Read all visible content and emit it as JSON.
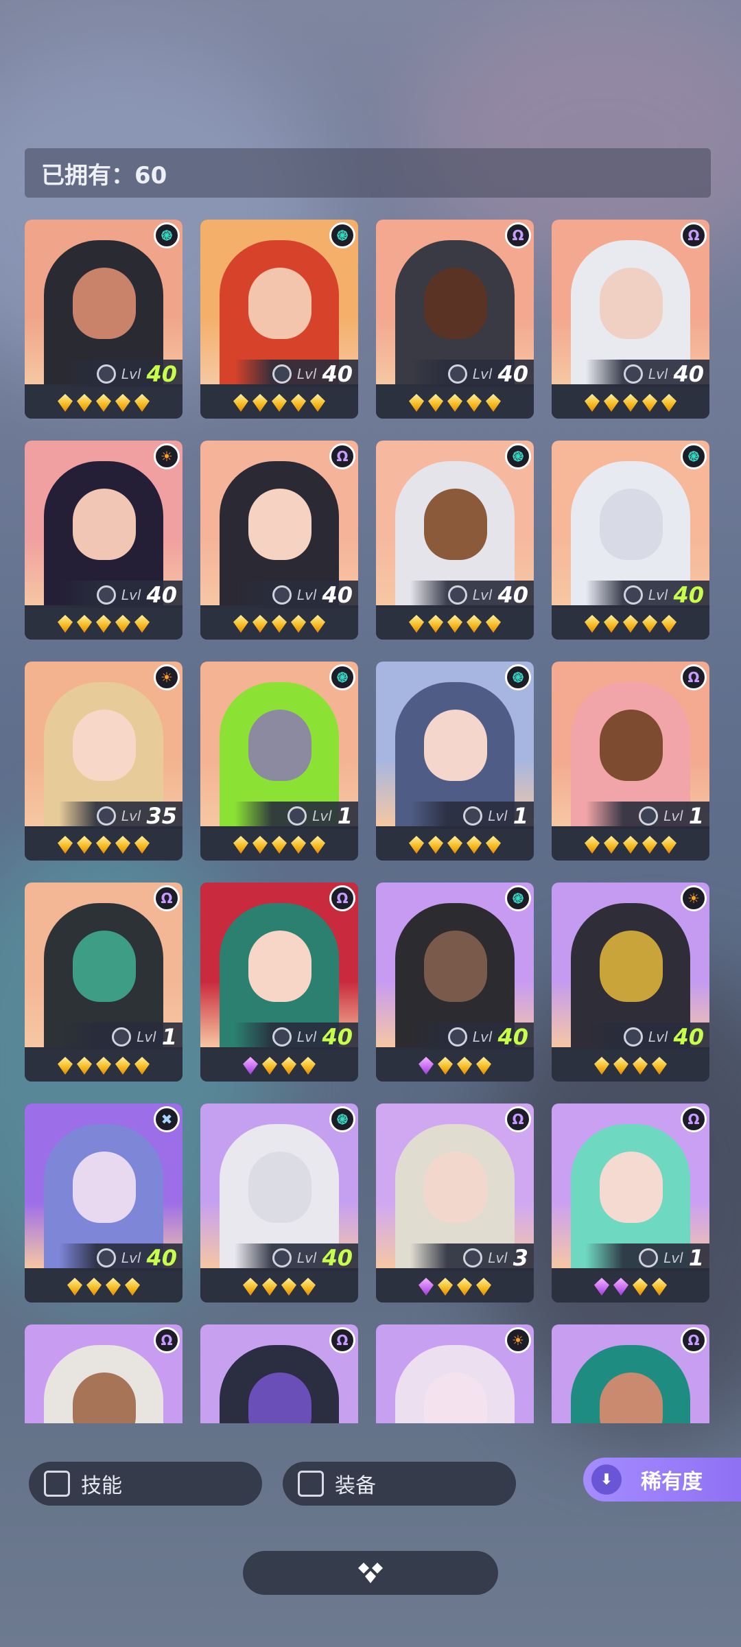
{
  "header": {
    "owned_text": "已拥有：60"
  },
  "lvl_prefix": "Lvl",
  "cards": [
    {
      "level": "40",
      "rarity": "swirl",
      "stars": [
        "gold",
        "gold",
        "gold",
        "gold",
        "gold"
      ],
      "lvl_color": "#c8ff4a",
      "bg": "#f0a58a",
      "figure": "#2a2a33",
      "face": "#c8836a"
    },
    {
      "level": "40",
      "rarity": "swirl",
      "stars": [
        "gold",
        "gold",
        "gold",
        "gold",
        "gold"
      ],
      "lvl_color": "#ffffff",
      "bg": "#f4b06a",
      "figure": "#d7422a",
      "face": "#f3c5ad"
    },
    {
      "level": "40",
      "rarity": "omega",
      "stars": [
        "gold",
        "gold",
        "gold",
        "gold",
        "gold"
      ],
      "lvl_color": "#ffffff",
      "bg": "#f3a88f",
      "figure": "#3a3a44",
      "face": "#5a3324"
    },
    {
      "level": "40",
      "rarity": "omega",
      "stars": [
        "gold",
        "gold",
        "gold",
        "gold",
        "gold"
      ],
      "lvl_color": "#ffffff",
      "bg": "#f3a88f",
      "figure": "#e8eaf0",
      "face": "#f0d0c2"
    },
    {
      "level": "40",
      "rarity": "sun",
      "stars": [
        "gold",
        "gold",
        "gold",
        "gold",
        "gold"
      ],
      "lvl_color": "#ffffff",
      "bg": "#f0a0a0",
      "figure": "#241f36",
      "face": "#f2c6b4"
    },
    {
      "level": "40",
      "rarity": "omega",
      "stars": [
        "gold",
        "gold",
        "gold",
        "gold",
        "gold"
      ],
      "lvl_color": "#ffffff",
      "bg": "#f5b49a",
      "figure": "#2b2a34",
      "face": "#f6d2c3"
    },
    {
      "level": "40",
      "rarity": "swirl",
      "stars": [
        "gold",
        "gold",
        "gold",
        "gold",
        "gold"
      ],
      "lvl_color": "#ffffff",
      "bg": "#f6b9a0",
      "figure": "#e4e4ea",
      "face": "#8a5a3a"
    },
    {
      "level": "40",
      "rarity": "swirl",
      "stars": [
        "gold",
        "gold",
        "gold",
        "gold",
        "gold"
      ],
      "lvl_color": "#c8ff4a",
      "bg": "#f7b89a",
      "figure": "#e8eaf2",
      "face": "#d8dbe6"
    },
    {
      "level": "35",
      "rarity": "sun",
      "stars": [
        "gold",
        "gold",
        "gold",
        "gold",
        "gold"
      ],
      "lvl_color": "#ffffff",
      "bg": "#f3b38f",
      "figure": "#e7cc9a",
      "face": "#f7d7c8"
    },
    {
      "level": "1",
      "rarity": "swirl",
      "stars": [
        "gold",
        "gold",
        "gold",
        "gold",
        "gold"
      ],
      "lvl_color": "#ffffff",
      "bg": "#f4b494",
      "figure": "#8ce234",
      "face": "#8c8aa0"
    },
    {
      "level": "1",
      "rarity": "swirl",
      "stars": [
        "gold",
        "gold",
        "gold",
        "gold",
        "gold"
      ],
      "lvl_color": "#ffffff",
      "bg": "#a7b6e0",
      "figure": "#4f5d86",
      "face": "#f4d6cc"
    },
    {
      "level": "1",
      "rarity": "omega",
      "stars": [
        "gold",
        "gold",
        "gold",
        "gold",
        "gold"
      ],
      "lvl_color": "#ffffff",
      "bg": "#f3aa90",
      "figure": "#f1a5a8",
      "face": "#7d4b2f"
    },
    {
      "level": "1",
      "rarity": "omega",
      "stars": [
        "gold",
        "gold",
        "gold",
        "gold",
        "gold"
      ],
      "lvl_color": "#ffffff",
      "bg": "#f4b796",
      "figure": "#2d3236",
      "face": "#3d9d85"
    },
    {
      "level": "40",
      "rarity": "omega",
      "stars": [
        "purple",
        "gold",
        "gold",
        "gold"
      ],
      "lvl_color": "#c8ff4a",
      "bg": "#c92a3d",
      "figure": "#2b8070",
      "face": "#f7d6c8"
    },
    {
      "level": "40",
      "rarity": "swirl",
      "stars": [
        "purple",
        "gold",
        "gold",
        "gold"
      ],
      "lvl_color": "#c8ff4a",
      "bg": "#c79bf2",
      "figure": "#2b2b30",
      "face": "#7a5a4a"
    },
    {
      "level": "40",
      "rarity": "sun",
      "stars": [
        "gold",
        "gold",
        "gold",
        "gold"
      ],
      "lvl_color": "#c8ff4a",
      "bg": "#c49bf0",
      "figure": "#2e2d38",
      "face": "#c9a43a"
    },
    {
      "level": "40",
      "rarity": "cross",
      "stars": [
        "gold",
        "gold",
        "gold",
        "gold"
      ],
      "lvl_color": "#c8ff4a",
      "bg": "#9c6ee8",
      "figure": "#7e86d8",
      "face": "#e8d8f0"
    },
    {
      "level": "40",
      "rarity": "swirl",
      "stars": [
        "gold",
        "gold",
        "gold",
        "gold"
      ],
      "lvl_color": "#c8ff4a",
      "bg": "#c6a0f0",
      "figure": "#e8e8ee",
      "face": "#dcdce4"
    },
    {
      "level": "3",
      "rarity": "omega",
      "stars": [
        "purple",
        "gold",
        "gold",
        "gold"
      ],
      "lvl_color": "#ffffff",
      "bg": "#d0a8f2",
      "figure": "#e0dcd0",
      "face": "#f2d8cc"
    },
    {
      "level": "1",
      "rarity": "omega",
      "stars": [
        "purple",
        "purple",
        "gold",
        "gold"
      ],
      "lvl_color": "#ffffff",
      "bg": "#caa0f2",
      "figure": "#6ed8c0",
      "face": "#f4dad0"
    },
    {
      "level": "",
      "rarity": "omega",
      "stars": [],
      "lvl_color": "#ffffff",
      "bg": "#c89cf0",
      "figure": "#e8e4e0",
      "face": "#a87458"
    },
    {
      "level": "",
      "rarity": "omega",
      "stars": [],
      "lvl_color": "#ffffff",
      "bg": "#c8a0f0",
      "figure": "#2a2e40",
      "face": "#6b4fb8"
    },
    {
      "level": "",
      "rarity": "sun",
      "stars": [],
      "lvl_color": "#ffffff",
      "bg": "#c8a0f2",
      "figure": "#ecdff0",
      "face": "#f4e2ee"
    },
    {
      "level": "",
      "rarity": "omega",
      "stars": [],
      "lvl_color": "#ffffff",
      "bg": "#c89ef0",
      "figure": "#1f8c82",
      "face": "#c98a70"
    }
  ],
  "filters": {
    "skill_label": "技能",
    "equipment_label": "装备",
    "sort_label": "稀有度"
  },
  "icons": {
    "swirl_color": "#38d9c4",
    "omega_color": "#c79cff",
    "sun_color": "#ff9d2a",
    "cross_color": "#a8d8ff"
  }
}
